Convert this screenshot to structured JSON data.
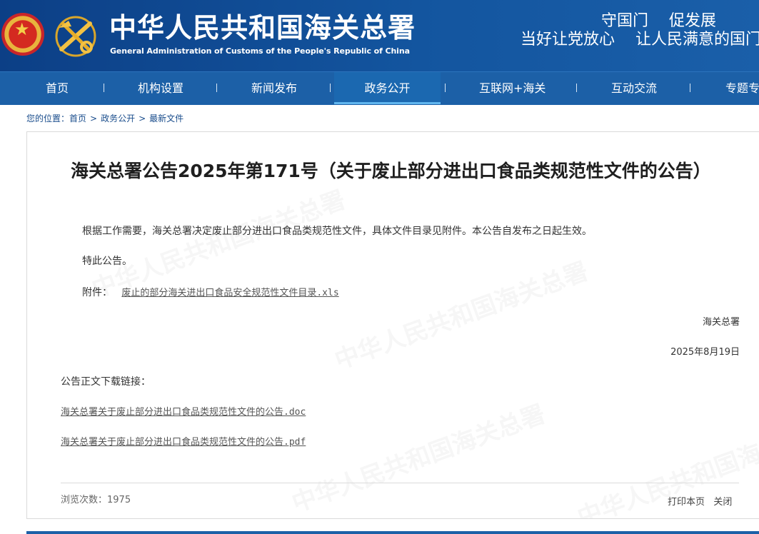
{
  "header": {
    "site_title": "中华人民共和国海关总署",
    "site_subtitle": "General Administration of Customs of the People's Republic of China",
    "slogan_line1": "守国门　 促发展",
    "slogan_line2": "当好让党放心　 让人民满意的国门",
    "watermark_text": "中华人民共和国海关总署"
  },
  "nav": {
    "items": [
      {
        "label": "首页"
      },
      {
        "label": "机构设置"
      },
      {
        "label": "新闻发布"
      },
      {
        "label": "政务公开"
      },
      {
        "label": "互联网+海关"
      },
      {
        "label": "互动交流"
      },
      {
        "label": "专题专栏"
      }
    ]
  },
  "breadcrumb": {
    "prefix": "您的位置：",
    "items": [
      "首页",
      "政务公开",
      "最新文件"
    ],
    "separator": ">"
  },
  "article": {
    "title": "海关总署公告2025年第171号（关于废止部分进出口食品类规范性文件的公告）",
    "paragraph1": "根据工作需要，海关总署决定废止部分进出口食品类规范性文件，具体文件目录见附件。本公告自发布之日起生效。",
    "paragraph2": "特此公告。",
    "attachment_label": "附件：",
    "attachment_link": "废止的部分海关进出口食品安全规范性文件目录.xls",
    "signature": "海关总署",
    "date": "2025年8月19日",
    "download_label": "公告正文下载链接：",
    "download_links": [
      "海关总署关于废止部分进出口食品类规范性文件的公告.doc",
      "海关总署关于废止部分进出口食品类规范性文件的公告.pdf"
    ]
  },
  "footer": {
    "views_text": "浏览次数：1975",
    "print_label": "打印本页",
    "close_label": "关闭"
  },
  "colors": {
    "header_blue": "#0c3f86",
    "nav_blue": "#1c60a7",
    "active_underline": "#61b6ee",
    "breadcrumb_text": "#1a4d8c"
  }
}
